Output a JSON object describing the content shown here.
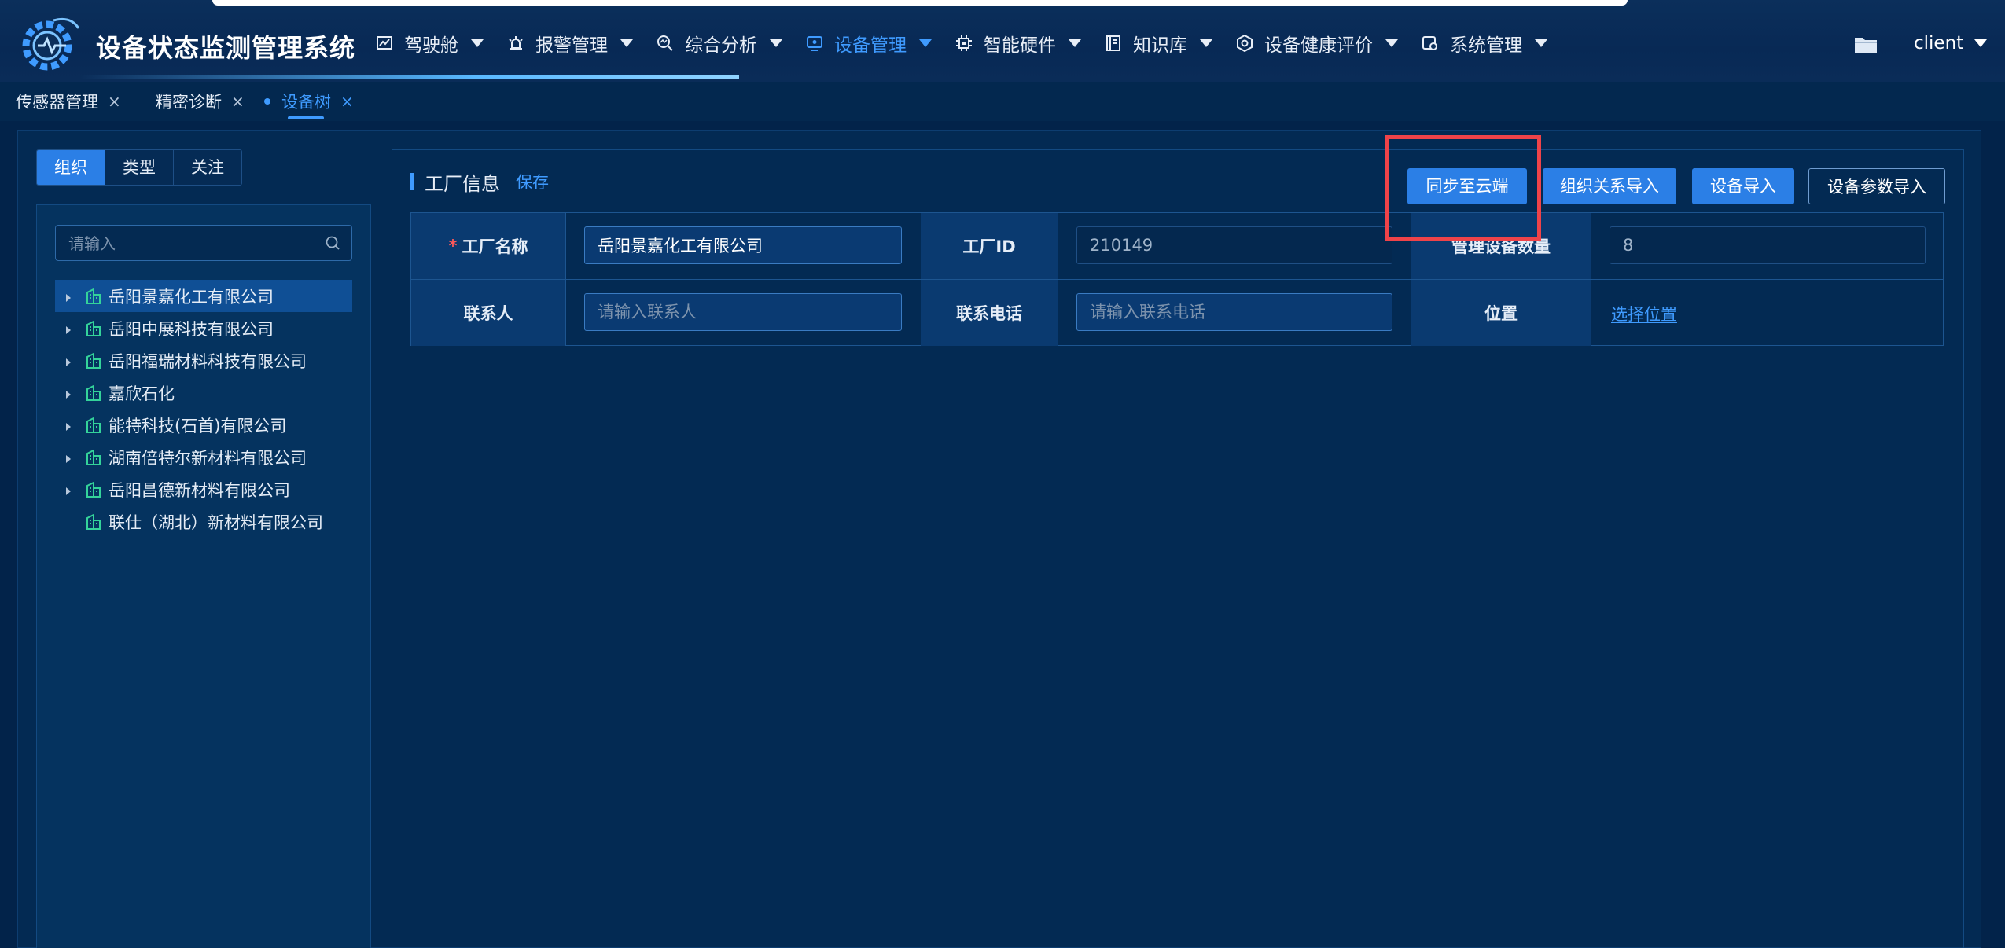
{
  "app": {
    "title": "设备状态监测管理系统",
    "user": "client"
  },
  "menu": [
    {
      "label": "驾驶舱",
      "icon": "chart-line-icon"
    },
    {
      "label": "报警管理",
      "icon": "alarm-light-icon"
    },
    {
      "label": "综合分析",
      "icon": "analysis-search-icon"
    },
    {
      "label": "设备管理",
      "icon": "monitor-icon",
      "active": true
    },
    {
      "label": "智能硬件",
      "icon": "chip-icon"
    },
    {
      "label": "知识库",
      "icon": "book-icon"
    },
    {
      "label": "设备健康评价",
      "icon": "hexagon-gear-icon"
    },
    {
      "label": "系统管理",
      "icon": "settings-icon"
    }
  ],
  "tabs": [
    {
      "label": "传感器管理",
      "close": "×"
    },
    {
      "label": "精密诊断",
      "close": "×"
    },
    {
      "label": "设备树",
      "close": "×",
      "active": true
    }
  ],
  "segment": {
    "options": [
      "组织",
      "类型",
      "关注"
    ],
    "selected": "组织"
  },
  "tree": {
    "search_placeholder": "请输入",
    "items": [
      {
        "label": "岳阳景嘉化工有限公司",
        "expandable": true,
        "selected": true
      },
      {
        "label": "岳阳中展科技有限公司",
        "expandable": true
      },
      {
        "label": "岳阳福瑞材料科技有限公司",
        "expandable": true
      },
      {
        "label": "嘉欣石化",
        "expandable": true
      },
      {
        "label": "能特科技(石首)有限公司",
        "expandable": true
      },
      {
        "label": "湖南倍特尔新材料有限公司",
        "expandable": true
      },
      {
        "label": "岳阳昌德新材料有限公司",
        "expandable": true
      },
      {
        "label": "联仕（湖北）新材料有限公司",
        "expandable": false
      }
    ]
  },
  "factory": {
    "section_title": "工厂信息",
    "save_label": "保存",
    "buttons": {
      "sync": "同步至云端",
      "org_import": "组织关系导入",
      "device_import": "设备导入",
      "param_import": "设备参数导入"
    },
    "fields": {
      "name_label": "工厂名称",
      "name_required": "*",
      "name_value": "岳阳景嘉化工有限公司",
      "id_label": "工厂ID",
      "id_value": "210149",
      "count_label": "管理设备数量",
      "count_value": "8",
      "contact_label": "联系人",
      "contact_placeholder": "请输入联系人",
      "phone_label": "联系电话",
      "phone_placeholder": "请输入联系电话",
      "location_label": "位置",
      "location_link": "选择位置"
    }
  },
  "colors": {
    "accent": "#3f9bff",
    "primary_button": "#2b7fe6",
    "background": "#02234a",
    "highlight_box": "#ef4349",
    "tree_icon": "#34d39a"
  }
}
